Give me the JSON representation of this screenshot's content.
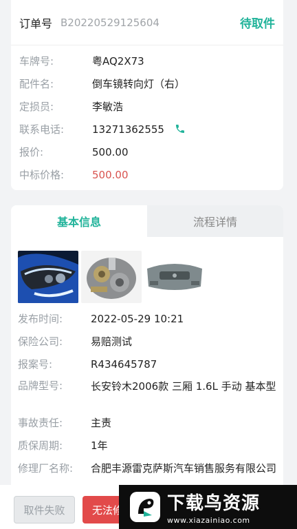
{
  "order": {
    "label": "订单号",
    "number": "B20220529125604",
    "status": "待取件",
    "rows": [
      {
        "key": "车牌号:",
        "value": "粤AQ2X73"
      },
      {
        "key": "配件名:",
        "value": "倒车镜转向灯（右）"
      },
      {
        "key": "定损员:",
        "value": "李敏浩"
      },
      {
        "key": "联系电话:",
        "value": "13271362555"
      },
      {
        "key": "报价:",
        "value": "500.00"
      },
      {
        "key": "中标价格:",
        "value": "500.00"
      }
    ]
  },
  "tabs": [
    {
      "label": "基本信息"
    },
    {
      "label": "流程详情"
    }
  ],
  "info": {
    "rows": [
      {
        "key": "发布时间:",
        "value": "2022-05-29 10:21"
      },
      {
        "key": "保险公司:",
        "value": "易赔测试"
      },
      {
        "key": "报案号:",
        "value": "R434645787"
      },
      {
        "key": "品牌型号:",
        "value": "长安铃木2006款 三厢 1.6L 手动 基本型"
      },
      {
        "key": "事故责任:",
        "value": "主责"
      },
      {
        "key": "质保周期:",
        "value": "1年"
      },
      {
        "key": "修理厂名称:",
        "value": "合肥丰源雷克萨斯汽车销售服务有限公司"
      }
    ]
  },
  "buttons": {
    "fail": "取件失败",
    "cannot": "无法修"
  },
  "watermark": {
    "title": "下载鸟资源",
    "url": "www.xiazainiao.com"
  },
  "colors": {
    "accent": "#21b39a",
    "price": "#d9534f",
    "danger": "#e24a4a"
  }
}
